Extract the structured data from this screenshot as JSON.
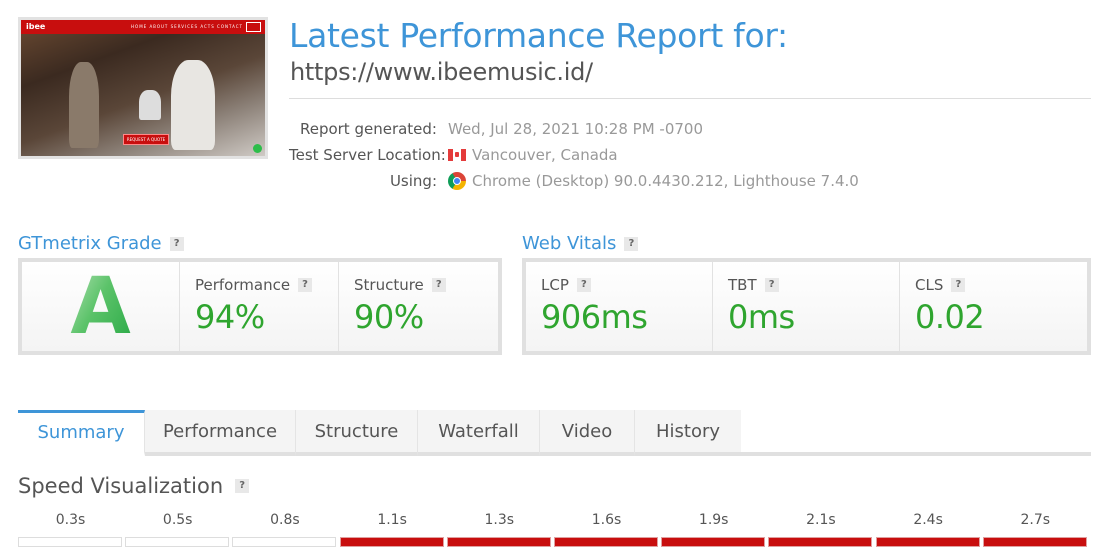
{
  "screenshot": {
    "site_logo": "ibee",
    "nav_links": "HOME  ABOUT  SERVICES  ACTS  CONTACT",
    "cta": "REQUEST A QUOTE"
  },
  "header": {
    "title": "Latest Performance Report for:",
    "url": "https://www.ibeemusic.id/"
  },
  "meta": {
    "report_generated_label": "Report generated:",
    "report_generated_value": "Wed, Jul 28, 2021 10:28 PM -0700",
    "location_label": "Test Server Location:",
    "location_value": "Vancouver, Canada",
    "location_icon": "canada-flag-icon",
    "using_label": "Using:",
    "using_value": "Chrome (Desktop) 90.0.4430.212, Lighthouse 7.4.0",
    "using_icon": "chrome-icon"
  },
  "grade": {
    "title": "GTmetrix Grade",
    "help": "?",
    "letter": "A",
    "performance_label": "Performance",
    "performance_value": "94%",
    "structure_label": "Structure",
    "structure_value": "90%"
  },
  "vitals": {
    "title": "Web Vitals",
    "help": "?",
    "lcp_label": "LCP",
    "lcp_value": "906ms",
    "tbt_label": "TBT",
    "tbt_value": "0ms",
    "cls_label": "CLS",
    "cls_value": "0.02"
  },
  "tabs": [
    {
      "label": "Summary",
      "active": true
    },
    {
      "label": "Performance"
    },
    {
      "label": "Structure"
    },
    {
      "label": "Waterfall"
    },
    {
      "label": "Video"
    },
    {
      "label": "History"
    }
  ],
  "speed_viz": {
    "title": "Speed Visualization",
    "help": "?",
    "frames": [
      {
        "time": "0.3s",
        "loaded": false
      },
      {
        "time": "0.5s",
        "loaded": false
      },
      {
        "time": "0.8s",
        "loaded": false
      },
      {
        "time": "1.1s",
        "loaded": true
      },
      {
        "time": "1.3s",
        "loaded": true
      },
      {
        "time": "1.6s",
        "loaded": true
      },
      {
        "time": "1.9s",
        "loaded": true
      },
      {
        "time": "2.1s",
        "loaded": true
      },
      {
        "time": "2.4s",
        "loaded": true
      },
      {
        "time": "2.7s",
        "loaded": true
      }
    ]
  },
  "colors": {
    "accent": "#3e95d8",
    "good": "#2fa52f",
    "site_red": "#c80e0e"
  }
}
